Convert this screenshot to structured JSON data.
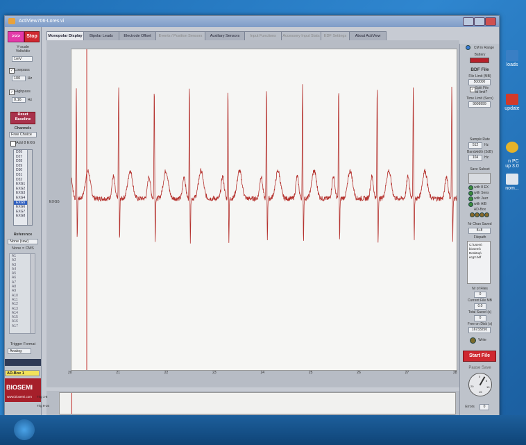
{
  "window": {
    "title": "ActiView706-Lores.vi"
  },
  "desktop": {
    "icons": [
      {
        "label": "loads",
        "color": "#3a7fc4"
      },
      {
        "label": "update",
        "color": "#d23a2a"
      },
      {
        "label": "n PC\nup 3.0",
        "color": "#e5b32a"
      },
      {
        "label": "nom...",
        "color": "#dfe6ee"
      }
    ]
  },
  "left": {
    "start_label": ">>>",
    "stop_label": "Stop",
    "yscale_label": "Y-scale\nVolts/div",
    "yscale_value": "1mV",
    "lowpass_label": "Lowpass",
    "lowpass_value": "100",
    "lowpass_unit": "Hz",
    "highpass_label": "Highpass",
    "highpass_value": "0.16",
    "highpass_unit": "Hz",
    "reset_label": "Reset\nBaseline",
    "channels_label": "Channels",
    "channels_mode": "Free Choice",
    "add_exg_label": "Add 8 EXG",
    "channel_items": [
      "D26",
      "D27",
      "D28",
      "D29",
      "D30",
      "D31",
      "D32",
      "EXG1",
      "EXG2",
      "EXG3",
      "EXG4",
      "EXG5",
      "EXG6",
      "EXG7",
      "EXG8"
    ],
    "selected_index": 11,
    "reference_label": "Reference",
    "reference_value": "None (raw)",
    "reference_sub": "None = CMS",
    "ref_items": [
      "A1",
      "A2",
      "A3",
      "A4",
      "A5",
      "A6",
      "A7",
      "A8",
      "A9",
      "A10",
      "A11",
      "A12",
      "A13",
      "A14",
      "A15",
      "A16",
      "A17"
    ],
    "trigger_format_label": "Trigger Format",
    "trigger_format_value": "Analog",
    "ao_box_value": "AD-Box 1",
    "logo": "BIOSEMI",
    "logo_url_text": "www.biosemi.com"
  },
  "tabs": [
    {
      "label": "Monopolar Display",
      "state": "active"
    },
    {
      "label": "Bipolar Leads",
      "state": "normal"
    },
    {
      "label": "Electrode Offset",
      "state": "normal"
    },
    {
      "label": "Events / Position Sensors",
      "state": "faded"
    },
    {
      "label": "Auxiliary Sensors",
      "state": "normal"
    },
    {
      "label": "Input Functions",
      "state": "faded"
    },
    {
      "label": "Accessory Input Stats",
      "state": "faded"
    },
    {
      "label": "EDF Settings",
      "state": "faded"
    },
    {
      "label": "About ActiView",
      "state": "normal"
    }
  ],
  "plot": {
    "channel_label": "EXG5",
    "trace_color": "#b5322e",
    "cursor_color": "#c1322e",
    "x_ticks": [
      "20",
      "21",
      "22",
      "23",
      "24",
      "25",
      "26",
      "27",
      "28"
    ]
  },
  "chart_data": {
    "type": "line",
    "x_ticks": [
      "20",
      "21",
      "22",
      "23",
      "24",
      "25",
      "26",
      "27",
      "28"
    ],
    "xlim": [
      20,
      28
    ],
    "beats_x": [
      20.1,
      20.98,
      21.72,
      22.45,
      23.25,
      24.05,
      24.8,
      25.55,
      26.35,
      27.1,
      27.9
    ]
  },
  "trigger_strip": {
    "label1": "Trig 1-8",
    "label2": "Trig 9-16"
  },
  "right": {
    "cm_range_label": "CM in Range",
    "battery_label": "Battery",
    "bdf_title": "BDF File",
    "file_limit_label": "File Limit (MB)",
    "file_limit_value": "500000",
    "split_label": "Split File\nat limit?",
    "time_limit_label": "Time Limit (Secs)",
    "time_limit_value": "9999999",
    "sample_rate_label": "Sample Rate",
    "sample_rate_value": "512",
    "sample_rate_unit": "Hz",
    "bandwidth_label": "Bandwidth (3dB)",
    "bandwidth_value": "104",
    "bandwidth_unit": "Hz",
    "save_subset_label": "Save Subset",
    "with8exg": "with 8 EX",
    "with_sens": "with Sens",
    "with_jazz": "with Jazz",
    "with_aib": "with AIB",
    "ao_box": "AD-Box",
    "nchan_label": "Nr Chan Saved",
    "nchan_value": "8+8",
    "filepath_label": "Filepath",
    "filepath_value": "C:\\Users\\\nbiosemi\\\nDesktop\\\necg2.bdf",
    "nfiles_label": "Nr of Files",
    "nfiles_value": "0",
    "current_mb_label": "Current File MB",
    "current_mb_value": "0.0",
    "total_saved_label": "Total Saved (s)",
    "total_saved_value": "0",
    "free_disk_label": "Free on Disk (s)",
    "free_disk_value": "16733250",
    "write_label": "Write",
    "start_file_label": "Start File",
    "pause_save_label": "Pause Save",
    "errors_label": "Errors",
    "errors_value": "0",
    "dial_values": [
      "0",
      "5",
      "10",
      "15",
      "20"
    ]
  }
}
